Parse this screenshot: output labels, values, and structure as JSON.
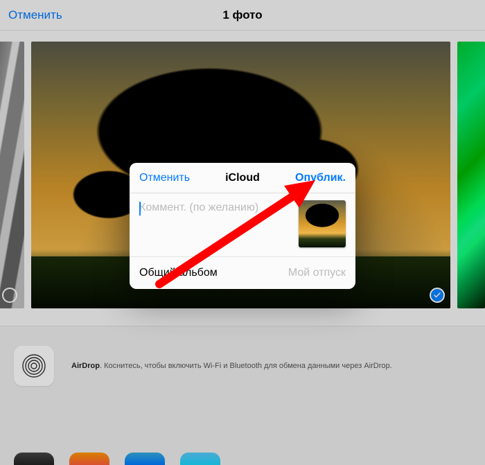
{
  "topbar": {
    "cancel_label": "Отменить",
    "title": "1 фото"
  },
  "airdrop": {
    "name_bold": "AirDrop",
    "hint_rest": ". Коснитесь, чтобы включить Wi-Fi и Bluetooth для обмена данными через AirDrop."
  },
  "modal": {
    "cancel_label": "Отменить",
    "title": "iCloud",
    "publish_label": "Опублик.",
    "comment_placeholder": "Коммент. (по желанию)",
    "comment_value": "",
    "footer_left": "Общий альбом",
    "footer_right": "Мой отпуск"
  },
  "colors": {
    "ios_blue": "#007aff",
    "arrow_red": "#ff0000"
  },
  "app_icons": [
    {
      "name": "app-1",
      "bg": "linear-gradient(#444,#222)"
    },
    {
      "name": "app-2",
      "bg": "linear-gradient(#ff9500,#ff5e3a)"
    },
    {
      "name": "app-3",
      "bg": "linear-gradient(#34aadc,#007aff)"
    },
    {
      "name": "app-4",
      "bg": "linear-gradient(#5ac8fa,#1ad6fd)"
    }
  ]
}
